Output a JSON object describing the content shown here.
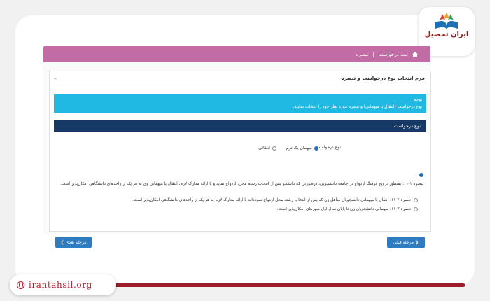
{
  "brand": {
    "logo_text": "ایران تحصیل",
    "url": "irantahsil.org"
  },
  "colors": {
    "topbar": "#c16ca5",
    "info_box": "#1fb9e4",
    "section_header": "#163a65",
    "button": "#2f7bbf",
    "brand_red": "#b51e2a"
  },
  "topbar": {
    "breadcrumb_home": "ثبت درخواست",
    "breadcrumb_sep": "|",
    "breadcrumb_current": "تبصره"
  },
  "panel": {
    "title": "فرم انتخاب نوع درخواست و تبصره",
    "minimize": "–",
    "info_title": "توجه :",
    "info_text": "نوع درخواست (انتقال یا میهمانی) و تبصره مورد نظر خود را انتخاب نمایید.",
    "section_title": "نوع درخواست",
    "request_type_label": "نوع درخواست",
    "options": [
      "میهمان یک ترم",
      "انتقالی"
    ],
    "selected_option": 0,
    "rule_text": "تبصره ۱-۱۱: بمنظور ترویج فرهنگ ازدواج در جامعه دانشجویی، درصورتی که دانشجو پس از انتخاب رشته محل، ازدواج نماید و با ارائه مدارک لازم، انتقال یا میهمانی وی به هر یک از واحدهای دانشگاهی امکان‌پذیر است.",
    "sub_rules": [
      "تبصره ۲-۱۱: انتقال یا میهمانی دانشجویان متأهل زن که پس از انتخاب رشته محل ازدواج نموده‌اند با ارائه مدارک لازم به هر یک از واحدهای دانشگاهی امکان‌پذیر است.",
      "تبصره ۳-۱۱: میهمانی دانشجویان زن تا پایان سال اول شهرهای امکان‌پذیر است."
    ],
    "prev_button": "مرحله قبلی",
    "next_button": "مرحله بعدی"
  }
}
